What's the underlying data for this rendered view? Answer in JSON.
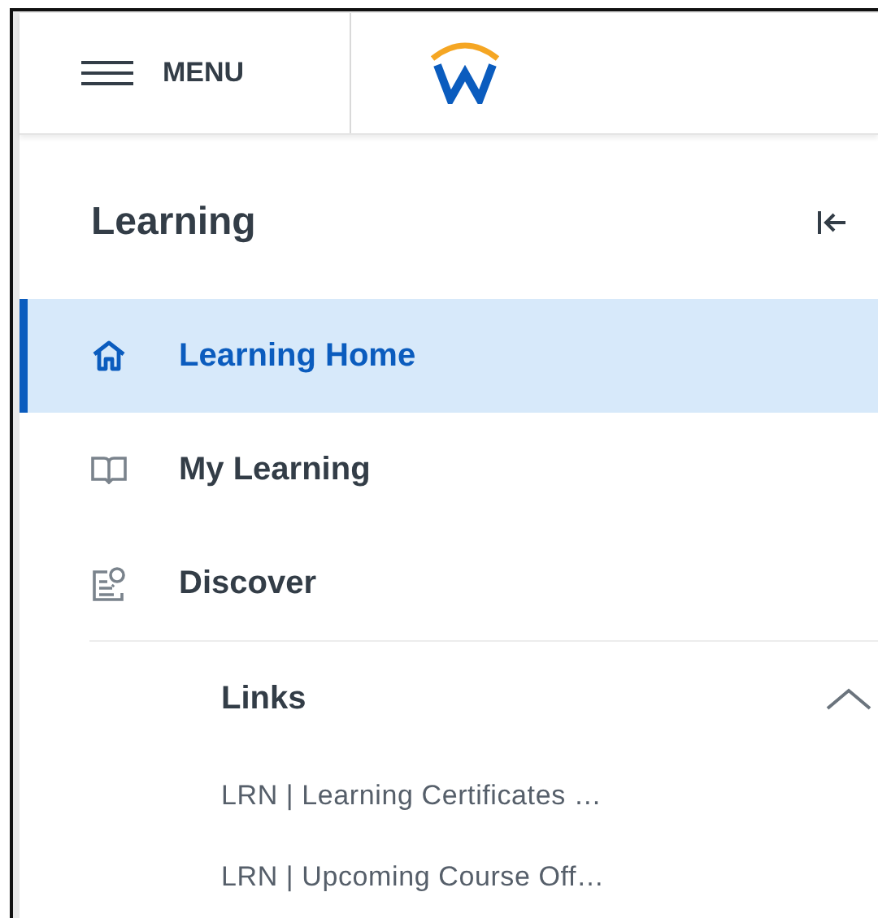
{
  "header": {
    "menu_label": "MENU"
  },
  "sidebar": {
    "title": "Learning",
    "items": [
      {
        "label": "Learning Home",
        "kind": "home",
        "selected": true
      },
      {
        "label": "My Learning",
        "kind": "book",
        "selected": false
      },
      {
        "label": "Discover",
        "kind": "discover",
        "selected": false
      }
    ],
    "links": {
      "title": "Links",
      "expanded": true,
      "items": [
        "LRN | Learning Certificates …",
        "LRN | Upcoming Course Off…"
      ]
    }
  }
}
